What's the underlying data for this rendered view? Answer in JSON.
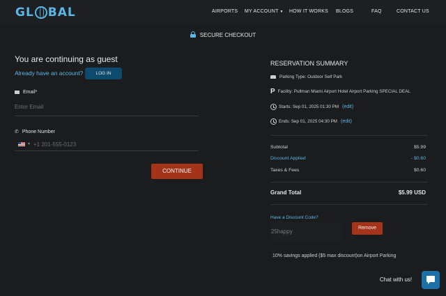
{
  "header": {
    "logo_text_left": "GL",
    "logo_text_right": "BAL",
    "nav": [
      "AIRPORTS",
      "MY ACCOUNT",
      "HOW IT WORKS",
      "BLOGS",
      "FAQ",
      "CONTACT US"
    ],
    "secure_label": "SECURE CHECKOUT"
  },
  "guest": {
    "title": "You are continuing as guest",
    "have_account": "Already have an account?",
    "login_label": "LOG IN",
    "email_label": "Email*",
    "email_placeholder": "Enter Email",
    "phone_label": "Phone Number",
    "phone_placeholder": "+1 201-555-0123",
    "continue_label": "CONTINUE"
  },
  "summary": {
    "title": "RESERVATION SUMMARY",
    "parking_type": "Parking Type: Outdoor Self Park",
    "facility": "Facility: Pullman Miami Airport Hotel Airport Parking SPECIAL DEAL",
    "starts": "Starts: Sep 01, 2025 01:30 PM",
    "ends": "Ends: Sep 01, 2025 04:30 PM",
    "edit_label": "(edit)",
    "subtotal_label": "Subtotal",
    "subtotal_value": "$5.99",
    "discount_label": "Discount Applied",
    "discount_value": "- $0.60",
    "taxes_label": "Taxes & Fees",
    "taxes_value": "$0.60",
    "grand_label": "Grand Total",
    "grand_value": "$5.99 USD",
    "discount_code_label": "Have a Discount Code?",
    "discount_code_value": "25happy",
    "remove_label": "Remove",
    "savings_text": "10% savings applied ($5 max discount)on Airport Parking"
  },
  "chat": {
    "label": "Chat with us!"
  },
  "colors": {
    "accent": "#5bb8e6",
    "button_red": "#a3341a",
    "login_blue": "#0e4a6e",
    "background": "#1b1c1e"
  }
}
